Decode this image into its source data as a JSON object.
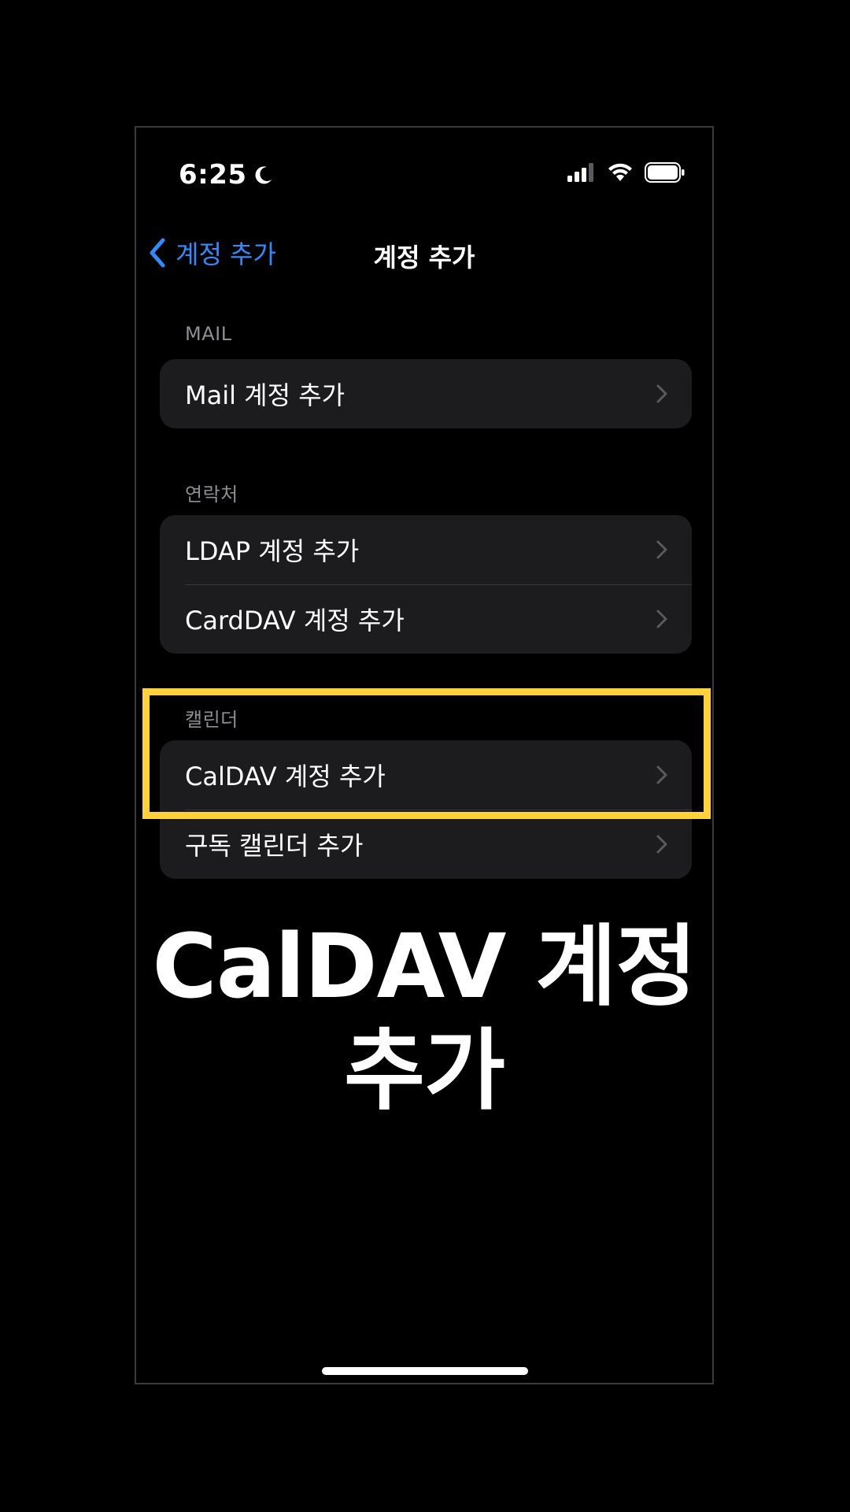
{
  "status_bar": {
    "time": "6:25",
    "focus_icon": "moon-icon",
    "icons": [
      "signal-icon",
      "wifi-icon",
      "battery-icon"
    ]
  },
  "nav": {
    "back_label": "계정 추가",
    "title": "계정 추가"
  },
  "sections": {
    "mail": {
      "header": "MAIL",
      "rows": [
        "Mail 계정 추가"
      ]
    },
    "contacts": {
      "header": "연락처",
      "rows": [
        "LDAP 계정 추가",
        "CardDAV 계정 추가"
      ]
    },
    "calendar": {
      "header": "캘린더",
      "rows": [
        "CalDAV 계정 추가",
        "구독 캘린더 추가"
      ]
    }
  },
  "caption": {
    "line1": "CalDAV 계정",
    "line2": "추가"
  },
  "colors": {
    "accent": "#2f8cff",
    "highlight": "#ffd23b",
    "group_bg": "#1c1c1e",
    "section_header": "#8e8e93"
  }
}
